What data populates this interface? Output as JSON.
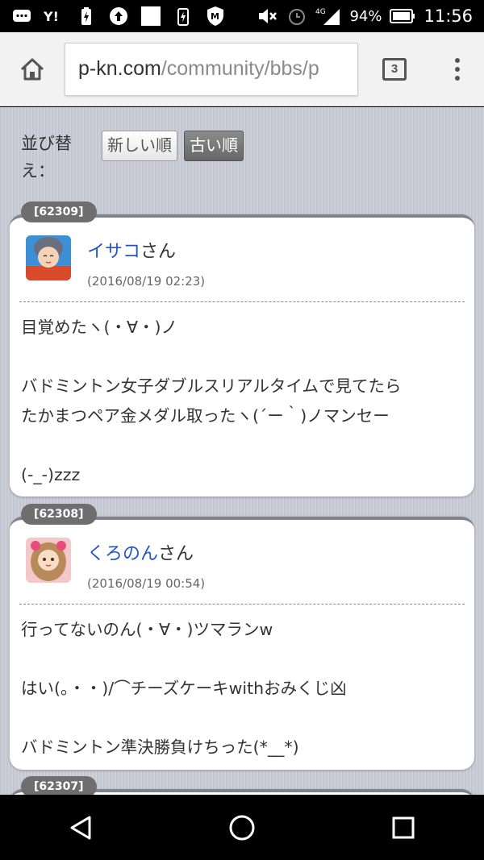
{
  "status": {
    "battery": "94%",
    "network": "4G",
    "time": "11:56"
  },
  "browser": {
    "url_host": "p-kn.com",
    "url_path": "/community/bbs/p",
    "tab_count": "3"
  },
  "sort": {
    "label": "並び替え：",
    "newest_label": "新しい順",
    "oldest_label": "古い順",
    "active": "oldest"
  },
  "posts": [
    {
      "id": "[62309]",
      "username": "イサコ",
      "suffix": "さん",
      "date": "(2016/08/19 02:23)",
      "lines": [
        "目覚めたヽ(・∀・)ノ",
        "",
        "バドミントン女子ダブルスリアルタイムで見てたら",
        "たかまつペア金メダル取ったヽ(´ー｀)ノマンセー",
        "",
        "(-_-)zzz"
      ]
    },
    {
      "id": "[62308]",
      "username": "くろのん",
      "suffix": "さん",
      "date": "(2016/08/19 00:54)",
      "lines": [
        "行ってないのん(・∀・)ツマランw",
        "",
        "はい(。・・)/⌒チーズケーキwithおみくじ凶",
        "",
        "バドミントン準決勝負けちった(*__*)"
      ]
    },
    {
      "id": "[62307]"
    }
  ],
  "colors": {
    "link": "#2255cc",
    "badge": "#6e6e6e",
    "background": "#c6c9d3"
  }
}
